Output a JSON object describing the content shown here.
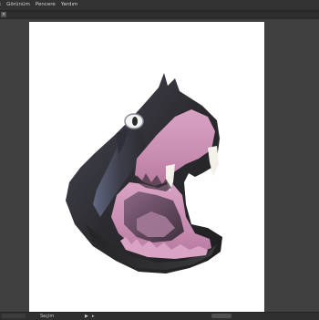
{
  "menubar": {
    "items": [
      "t",
      "Görünüm",
      "Pencere",
      "Yardım"
    ]
  },
  "tabbar": {
    "close_glyph": "×"
  },
  "statusbar": {
    "label": "Seçim",
    "arrow_right": "▶",
    "arrow_small": "▸"
  },
  "colors": {
    "ui_background": "#3b3b3b",
    "menubar": "#323232",
    "artboard": "#ffffff",
    "head_dark": "#2a2a2c",
    "mouth_pink": "#c98ab0",
    "tongue_purple": "#7a5c75"
  }
}
